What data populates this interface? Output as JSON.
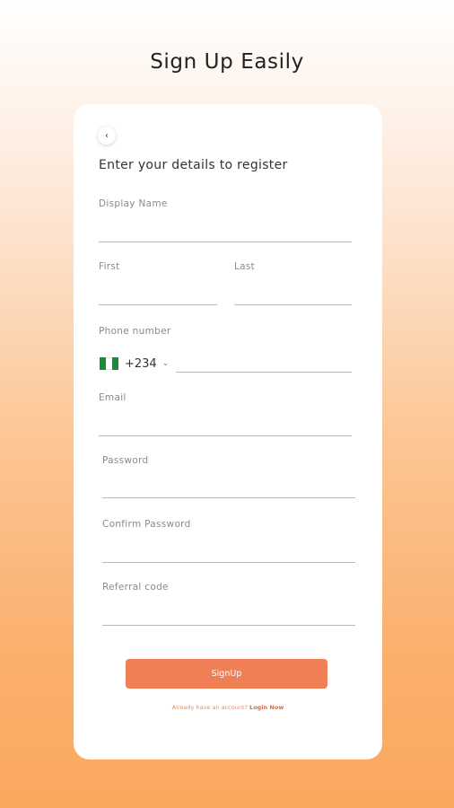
{
  "page": {
    "headline": "Sign Up Easily"
  },
  "form": {
    "subtitle": "Enter your details to register",
    "display_name": {
      "label": "Display Name",
      "value": ""
    },
    "first": {
      "label": "First",
      "value": ""
    },
    "last": {
      "label": "Last",
      "value": ""
    },
    "phone": {
      "label": "Phone number",
      "country_code": "+234",
      "flag": "nigeria-flag-icon",
      "value": ""
    },
    "email": {
      "label": "Email",
      "value": ""
    },
    "password": {
      "label": "Password",
      "value": ""
    },
    "confirm_password": {
      "label": "Confirm Password",
      "value": ""
    },
    "referral": {
      "label": "Referral code",
      "value": ""
    },
    "submit_label": "SignUp",
    "login_prompt": "Already have an account? ",
    "login_link": "Login Now"
  },
  "colors": {
    "accent": "#f07f56",
    "link": "#e5673d",
    "flag_green": "#1a8a3a"
  }
}
